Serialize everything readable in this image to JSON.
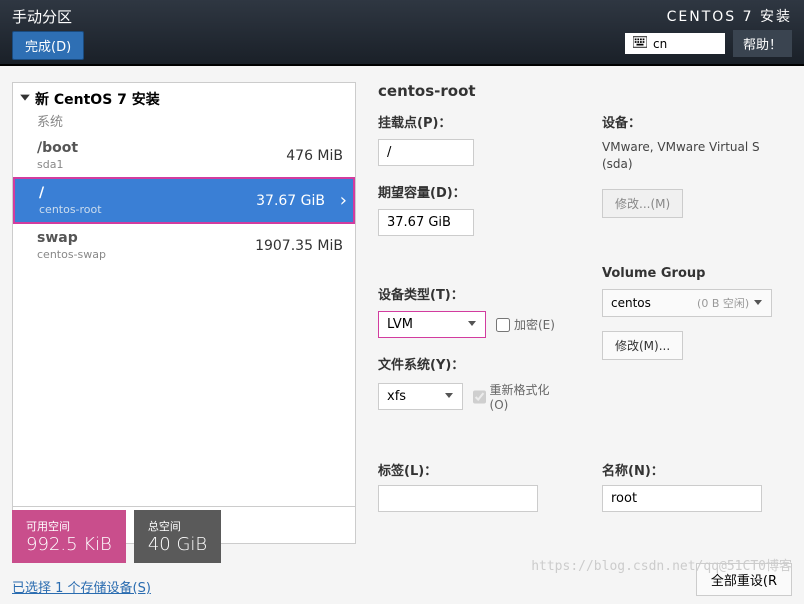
{
  "header": {
    "title": "手动分区",
    "done": "完成(D)",
    "installer": "CENTOS 7 安装",
    "lang": "cn",
    "help": "帮助！"
  },
  "tree": {
    "root": "新 CentOS 7 安装",
    "group": "系统",
    "items": [
      {
        "name": "/boot",
        "sub": "sda1",
        "size": "476 MiB"
      },
      {
        "name": "/",
        "sub": "centos-root",
        "size": "37.67 GiB"
      },
      {
        "name": "swap",
        "sub": "centos-swap",
        "size": "1907.35 MiB"
      }
    ]
  },
  "detail": {
    "title": "centos-root",
    "mount_label": "挂载点(P)：",
    "mount_value": "/",
    "desired_label": "期望容量(D)：",
    "desired_value": "37.67 GiB",
    "devtype_label": "设备类型(T)：",
    "devtype_value": "LVM",
    "encrypt_label": "加密(E)",
    "fs_label": "文件系统(Y)：",
    "fs_value": "xfs",
    "reformat_label": "重新格式化(O)",
    "label_label": "标签(L)：",
    "label_value": "",
    "device_label": "设备：",
    "device_text1": "VMware, VMware Virtual S",
    "device_text2": "(sda)",
    "modify_dev": "修改...(M)",
    "vg_label": "Volume Group",
    "vg_value": "centos",
    "vg_free": "(0 B 空闲)",
    "modify_vg": "修改(M)...",
    "name_label": "名称(N)：",
    "name_value": "root"
  },
  "footer": {
    "avail_label": "可用空间",
    "avail_value": "992.5 KiB",
    "total_label": "总空间",
    "total_value": "40 GiB",
    "storage_link": "已选择 1 个存储设备(S)",
    "reset": "全部重设(R",
    "watermark": "https://blog.csdn.net/qq@51CT0博客"
  }
}
